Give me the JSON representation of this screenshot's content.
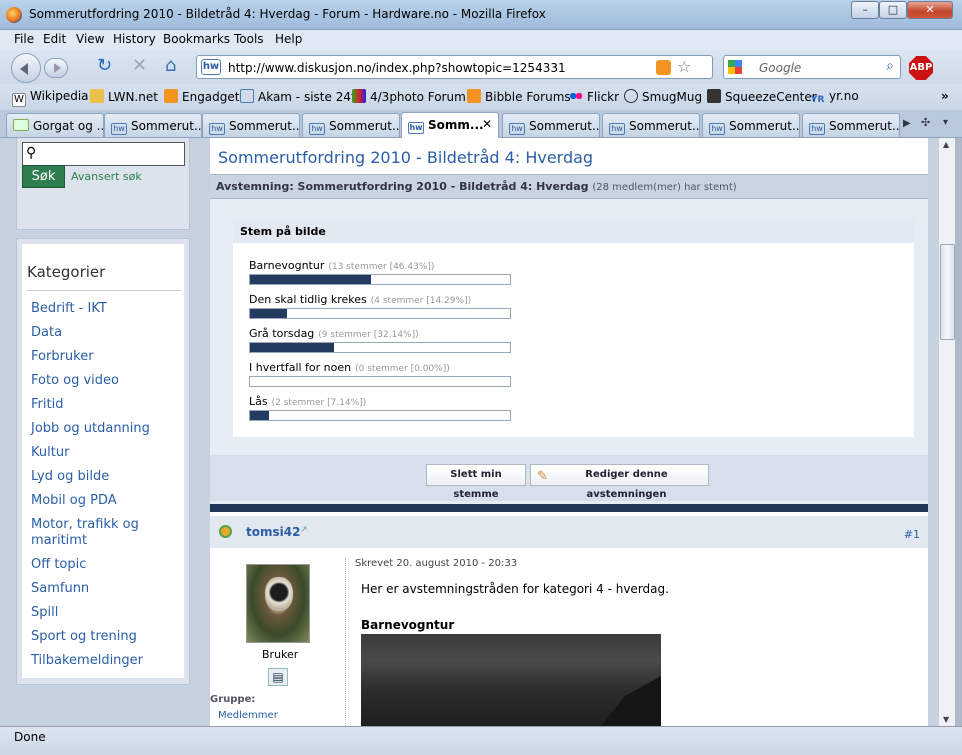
{
  "window": {
    "title": "Sommerutfordring 2010 - Bildetråd 4: Hverdag - Forum - Hardware.no - Mozilla Firefox",
    "minimize": "–",
    "maximize": "□",
    "close": "✕"
  },
  "menu": [
    "File",
    "Edit",
    "View",
    "History",
    "Bookmarks",
    "Tools",
    "Help"
  ],
  "nav": {
    "url": "http://www.diskusjon.no/index.php?showtopic=1254331",
    "search_placeholder": "Google",
    "abp": "ABP"
  },
  "bookmarks": [
    "Wikipedia",
    "LWN.net",
    "Engadget",
    "Akam - siste 24t",
    "4/3photo Forum",
    "Bibble Forums",
    "Flickr",
    "SmugMug",
    "SqueezeCenter",
    "yr.no"
  ],
  "bookmarks_more": "»",
  "tabs": [
    "Gorgat og ...",
    "Sommerut...",
    "Sommerut...",
    "Sommerut...",
    "Somm...",
    "Sommerut...",
    "Sommerut...",
    "Sommerut...",
    "Sommerut..."
  ],
  "active_tab_index": 4,
  "sidebar": {
    "search_button": "Søk",
    "advanced_search": "Avansert søk",
    "categories_title": "Kategorier",
    "categories": [
      "Bedrift - IKT",
      "Data",
      "Forbruker",
      "Foto og video",
      "Fritid",
      "Jobb og utdanning",
      "Kultur",
      "Lyd og bilde",
      "Mobil og PDA",
      "Motor, trafikk og maritimt",
      "Off topic",
      "Samfunn",
      "Spill",
      "Sport og trening",
      "Tilbakemeldinger"
    ]
  },
  "main": {
    "page_title": "Sommerutfordring 2010 - Bildetråd 4: Hverdag",
    "poll_header": "Avstemning: Sommerutfordring 2010 - Bildetråd 4: Hverdag",
    "poll_voters": "(28 medlem(mer) har stemt)",
    "vote_section_title": "Stem på bilde",
    "options": [
      {
        "label": "Barnevogntur",
        "votes": "(13 stemmer [46.43%])",
        "percent": 46.43
      },
      {
        "label": "Den skal tidlig krekes",
        "votes": "(4 stemmer [14.29%])",
        "percent": 14.29
      },
      {
        "label": "Grå torsdag",
        "votes": "(9 stemmer [32.14%])",
        "percent": 32.14
      },
      {
        "label": "I hvertfall for noen",
        "votes": "(0 stemmer [0.00%])",
        "percent": 0
      },
      {
        "label": "Lås",
        "votes": "(2 stemmer [7.14%])",
        "percent": 7.14
      }
    ],
    "delete_vote_button": "Slett min stemme",
    "edit_poll_button": "Rediger denne avstemningen"
  },
  "post": {
    "username": "tomsi42",
    "post_number": "#1",
    "role": "Bruker",
    "group_label": "Gruppe:",
    "group_value": "Medlemmer",
    "written": "Skrevet 20. august 2010 - 20:33",
    "text": "Her er avstemningstråden for kategori 4 - hverdag.",
    "image_title": "Barnevogntur"
  },
  "status": "Done"
}
